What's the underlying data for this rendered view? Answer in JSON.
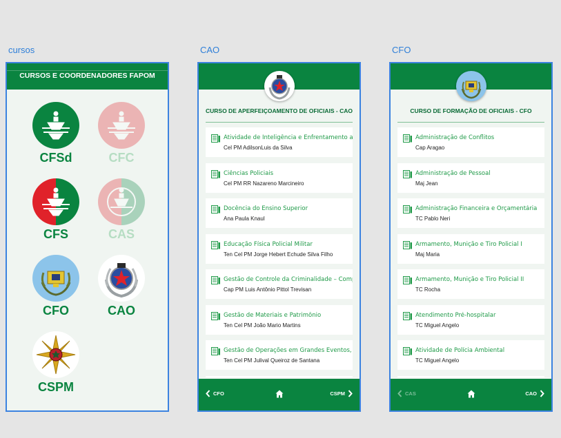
{
  "frames": {
    "cursos_label": "cursos",
    "cao_label": "CAO",
    "cfo_label": "CFO"
  },
  "cursos": {
    "header_title": "CURSOS E COORDENADORES FAPOM",
    "courses": [
      {
        "name": "CFSd",
        "active": true
      },
      {
        "name": "CFC",
        "active": false
      },
      {
        "name": "CFS",
        "active": true
      },
      {
        "name": "CAS",
        "active": false
      },
      {
        "name": "CFO",
        "active": true
      },
      {
        "name": "CAO",
        "active": true
      },
      {
        "name": "CSPM",
        "active": true
      }
    ]
  },
  "cao": {
    "title": "CURSO DE APERFEIÇOAMENTO DE OFICIAIS - CAO",
    "items": [
      {
        "subject": "Atividade de Inteligência e Enfrentamento ao",
        "teacher": "Cel PM AdilsonLuis da Silva"
      },
      {
        "subject": "Ciências Policiais",
        "teacher": "Cel PM RR Nazareno Marcineiro"
      },
      {
        "subject": "Docência do Ensino Superior",
        "teacher": "Ana Paula Knaul"
      },
      {
        "subject": "Educação Física Policial Militar",
        "teacher": "Ten Cel PM Jorge Hebert Echude Silva Filho"
      },
      {
        "subject": "Gestão de Controle da Criminalidade – Comp",
        "teacher": "Cap PM Luis Antônio Pittol Trevisan"
      },
      {
        "subject": "Gestão de Materiais e Patrimônio",
        "teacher": "Ten Cel PM João Mario Martins"
      },
      {
        "subject": "Gestão de Operações em Grandes Eventos, C",
        "teacher": "Ten Cel PM Julival Queiroz de Santana"
      }
    ],
    "nav": {
      "prev": "CFO",
      "next": "CSPM"
    }
  },
  "cfo": {
    "title": "CURSO DE FORMAÇÃO DE OFICIAIS - CFO",
    "items": [
      {
        "subject": "Administração de Conflitos",
        "teacher": "Cap Aragao"
      },
      {
        "subject": "Administração de Pessoal",
        "teacher": "Maj Jean"
      },
      {
        "subject": "Administração Financeira e Orçamentária",
        "teacher": "TC Pablo Neri"
      },
      {
        "subject": "Armamento, Munição e Tiro Policial I",
        "teacher": "Maj Maria"
      },
      {
        "subject": "Armamento, Munição e Tiro Policial II",
        "teacher": "TC Rocha"
      },
      {
        "subject": "Atendimento Pré-hospitalar",
        "teacher": "TC Miguel Angelo"
      },
      {
        "subject": "Atividade de Polícia Ambiental",
        "teacher": "TC Miguel Angelo"
      }
    ],
    "nav": {
      "prev": "CAS",
      "next": "CAO"
    }
  },
  "colors": {
    "green": "#0a8440",
    "red": "#e0222a",
    "blue_frame": "#3b82e0",
    "light_blue": "#8cc4ea"
  }
}
